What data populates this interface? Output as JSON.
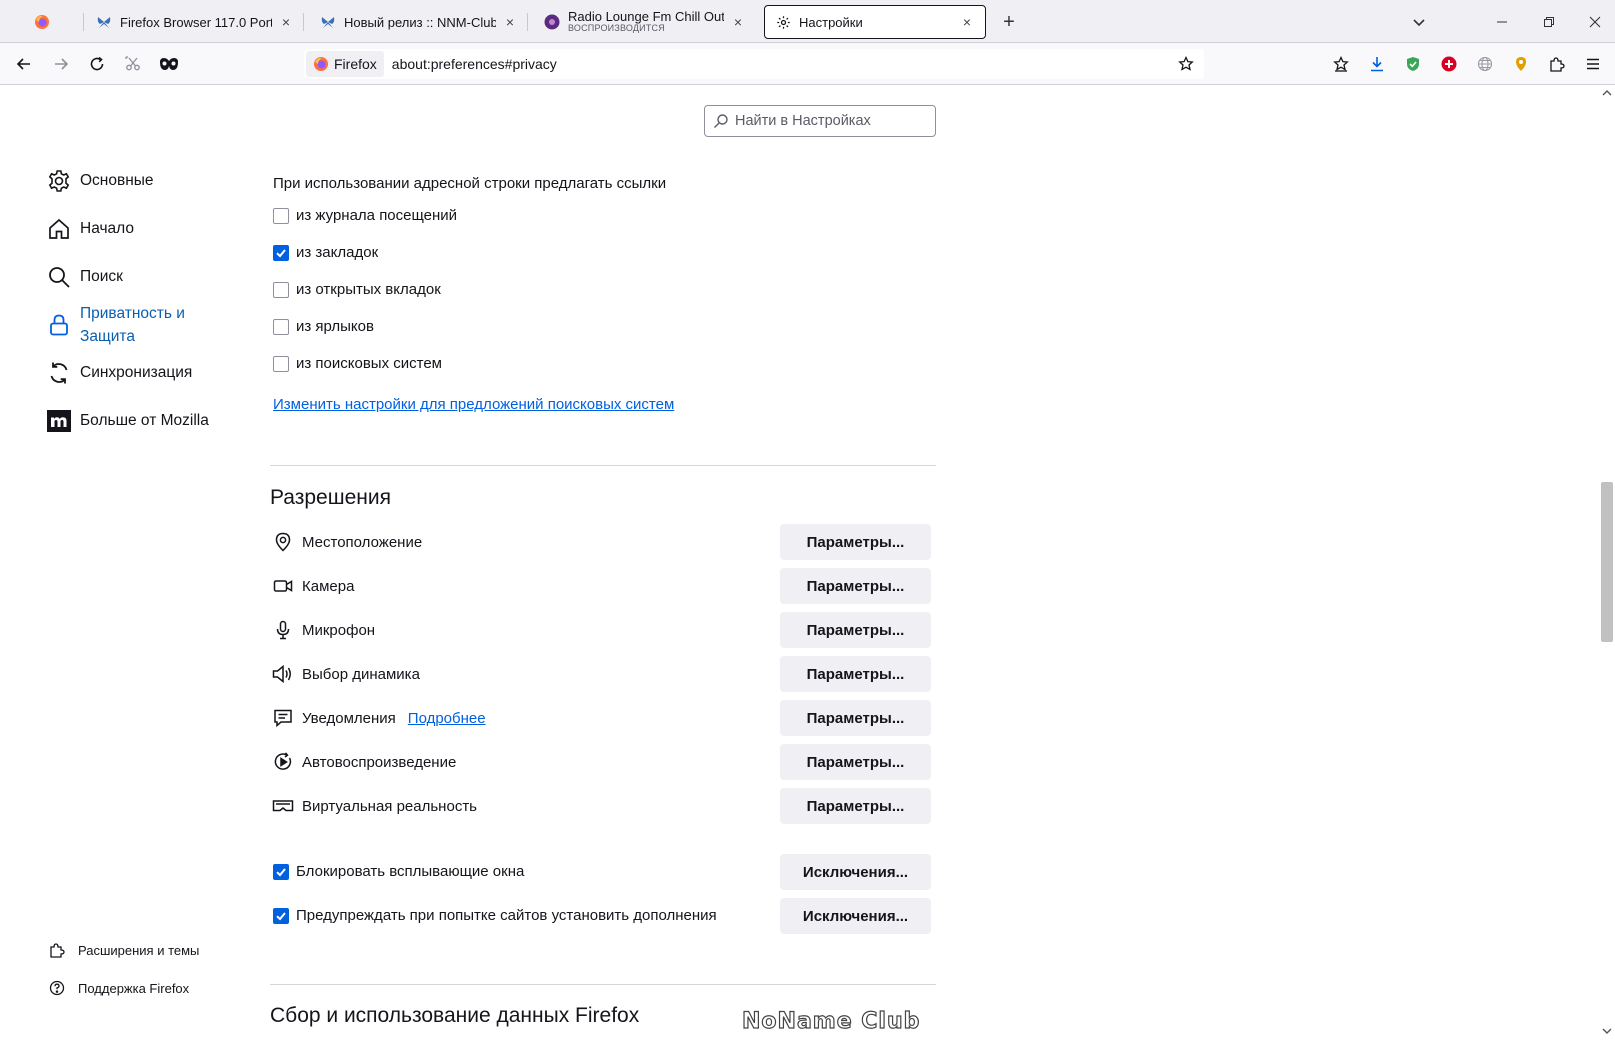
{
  "tabs": [
    {
      "title": "Firefox Browser 117.0 Portable by..."
    },
    {
      "title": "Новый релиз :: NNM-Club"
    },
    {
      "title": "Radio Lounge Fm Chill Out",
      "subtitle": "ВОСПРОИЗВОДИТСЯ"
    },
    {
      "title": "Настройки"
    }
  ],
  "close_glyph": "×",
  "newtab_glyph": "+",
  "urlbar": {
    "identity_label": "Firefox",
    "url": "about:preferences#privacy"
  },
  "search": {
    "placeholder": "Найти в Настройках"
  },
  "sidebar": {
    "items": [
      {
        "label": "Основные",
        "icon": "gear-icon"
      },
      {
        "label": "Начало",
        "icon": "home-icon"
      },
      {
        "label": "Поиск",
        "icon": "search-icon"
      },
      {
        "label": "Приватность и Защита",
        "icon": "lock-icon"
      },
      {
        "label": "Синхронизация",
        "icon": "sync-icon"
      },
      {
        "label": "Больше от Mozilla",
        "icon": "mozilla-icon"
      }
    ],
    "footer": [
      {
        "label": "Расширения и темы",
        "icon": "puzzle-icon"
      },
      {
        "label": "Поддержка Firefox",
        "icon": "help-icon"
      }
    ]
  },
  "addressbar": {
    "heading": "При использовании адресной строки предлагать ссылки",
    "options": [
      {
        "label": "из журнала посещений",
        "checked": false
      },
      {
        "label": "из закладок",
        "checked": true
      },
      {
        "label": "из открытых вкладок",
        "checked": false
      },
      {
        "label": "из ярлыков",
        "checked": false
      },
      {
        "label": "из поисковых систем",
        "checked": false
      }
    ],
    "link": "Изменить настройки для предложений поисковых систем"
  },
  "permissions": {
    "title": "Разрешения",
    "items": [
      {
        "label": "Местоположение",
        "icon": "location-icon",
        "button": "Параметры..."
      },
      {
        "label": "Камера",
        "icon": "camera-icon",
        "button": "Параметры..."
      },
      {
        "label": "Микрофон",
        "icon": "microphone-icon",
        "button": "Параметры..."
      },
      {
        "label": "Выбор динамика",
        "icon": "speaker-icon",
        "button": "Параметры..."
      },
      {
        "label": "Уведомления",
        "icon": "notification-icon",
        "button": "Параметры...",
        "link": "Подробнее"
      },
      {
        "label": "Автовоспроизведение",
        "icon": "autoplay-icon",
        "button": "Параметры..."
      },
      {
        "label": "Виртуальная реальность",
        "icon": "vr-icon",
        "button": "Параметры..."
      }
    ],
    "toggles": [
      {
        "label": "Блокировать всплывающие окна",
        "checked": true,
        "button": "Исключения..."
      },
      {
        "label": "Предупреждать при попытке сайтов установить дополнения",
        "checked": true,
        "button": "Исключения..."
      }
    ]
  },
  "next_section_title": "Сбор и использование данных Firefox",
  "watermark": "NoName Club",
  "colors": {
    "accent": "#0061e0",
    "tabstrip_bg": "#f0f0f4",
    "button_bg": "#f0f0f4"
  }
}
